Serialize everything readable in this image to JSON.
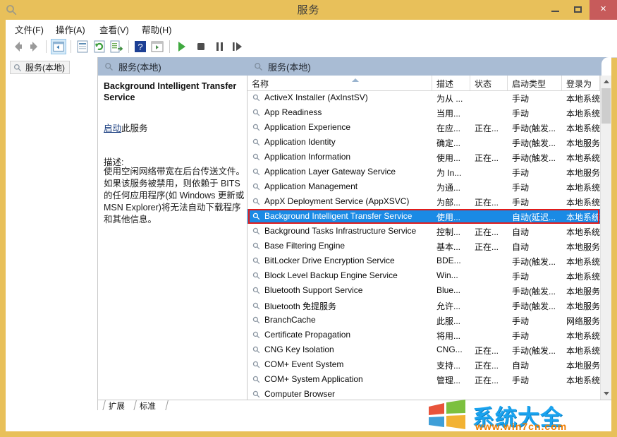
{
  "window": {
    "title": "服务",
    "icon": "services-gear-icon",
    "minimize_label": "最小化",
    "maximize_label": "最大化",
    "close_label": "×"
  },
  "menubar": {
    "items": [
      {
        "label": "文件(F)",
        "name": "menu-file"
      },
      {
        "label": "操作(A)",
        "name": "menu-action"
      },
      {
        "label": "查看(V)",
        "name": "menu-view"
      },
      {
        "label": "帮助(H)",
        "name": "menu-help"
      }
    ]
  },
  "toolbar": {
    "buttons": [
      {
        "name": "back-icon",
        "glyph": "back"
      },
      {
        "name": "forward-icon",
        "glyph": "forward"
      },
      {
        "name": "show-tree-icon",
        "glyph": "tree"
      },
      {
        "name": "properties-icon",
        "glyph": "props"
      },
      {
        "name": "refresh-icon",
        "glyph": "refresh"
      },
      {
        "name": "export-list-icon",
        "glyph": "export"
      },
      {
        "name": "help-icon",
        "glyph": "help"
      },
      {
        "name": "show-hide-icon",
        "glyph": "showhide"
      },
      {
        "name": "start-service-icon",
        "glyph": "play"
      },
      {
        "name": "stop-service-icon",
        "glyph": "stop"
      },
      {
        "name": "pause-service-icon",
        "glyph": "pause"
      },
      {
        "name": "restart-service-icon",
        "glyph": "restart"
      }
    ]
  },
  "tree": {
    "root_label": "服务(本地)",
    "root_icon": "services-gear-icon"
  },
  "details": {
    "header": "服务(本地)",
    "header_icon": "services-gear-icon",
    "service_name": "Background Intelligent Transfer Service",
    "action_link": "启动",
    "action_suffix": "此服务",
    "description_label": "描述:",
    "description": "使用空闲网络带宽在后台传送文件。如果该服务被禁用，则依赖于 BITS 的任何应用程序(如 Windows 更新或 MSN Explorer)将无法自动下载程序和其他信息。"
  },
  "list": {
    "header": "服务(本地)",
    "header_icon": "services-gear-icon",
    "sort_column": "名称",
    "sort_direction": "ascending",
    "columns": [
      {
        "key": "name",
        "label": "名称"
      },
      {
        "key": "desc",
        "label": "描述"
      },
      {
        "key": "status",
        "label": "状态"
      },
      {
        "key": "startup",
        "label": "启动类型"
      },
      {
        "key": "logon",
        "label": "登录为"
      }
    ],
    "selected_index": 8,
    "rows": [
      {
        "name": "ActiveX Installer (AxInstSV)",
        "desc": "为从 ...",
        "status": "",
        "startup": "手动",
        "logon": "本地系统"
      },
      {
        "name": "App Readiness",
        "desc": "当用...",
        "status": "",
        "startup": "手动",
        "logon": "本地系统"
      },
      {
        "name": "Application Experience",
        "desc": "在应...",
        "status": "正在...",
        "startup": "手动(触发...",
        "logon": "本地系统"
      },
      {
        "name": "Application Identity",
        "desc": "确定...",
        "status": "",
        "startup": "手动(触发...",
        "logon": "本地服务"
      },
      {
        "name": "Application Information",
        "desc": "使用...",
        "status": "正在...",
        "startup": "手动(触发...",
        "logon": "本地系统"
      },
      {
        "name": "Application Layer Gateway Service",
        "desc": "为 In...",
        "status": "",
        "startup": "手动",
        "logon": "本地服务"
      },
      {
        "name": "Application Management",
        "desc": "为通...",
        "status": "",
        "startup": "手动",
        "logon": "本地系统"
      },
      {
        "name": "AppX Deployment Service (AppXSVC)",
        "desc": "为部...",
        "status": "正在...",
        "startup": "手动",
        "logon": "本地系统"
      },
      {
        "name": "Background Intelligent Transfer Service",
        "desc": "使用...",
        "status": "",
        "startup": "自动(延迟...",
        "logon": "本地系统"
      },
      {
        "name": "Background Tasks Infrastructure Service",
        "desc": "控制...",
        "status": "正在...",
        "startup": "自动",
        "logon": "本地系统"
      },
      {
        "name": "Base Filtering Engine",
        "desc": "基本...",
        "status": "正在...",
        "startup": "自动",
        "logon": "本地服务"
      },
      {
        "name": "BitLocker Drive Encryption Service",
        "desc": "BDE...",
        "status": "",
        "startup": "手动(触发...",
        "logon": "本地系统"
      },
      {
        "name": "Block Level Backup Engine Service",
        "desc": "Win...",
        "status": "",
        "startup": "手动",
        "logon": "本地系统"
      },
      {
        "name": "Bluetooth Support Service",
        "desc": "Blue...",
        "status": "",
        "startup": "手动(触发...",
        "logon": "本地服务"
      },
      {
        "name": "Bluetooth 免提服务",
        "desc": "允许...",
        "status": "",
        "startup": "手动(触发...",
        "logon": "本地服务"
      },
      {
        "name": "BranchCache",
        "desc": "此服...",
        "status": "",
        "startup": "手动",
        "logon": "网络服务"
      },
      {
        "name": "Certificate Propagation",
        "desc": "将用...",
        "status": "",
        "startup": "手动",
        "logon": "本地系统"
      },
      {
        "name": "CNG Key Isolation",
        "desc": "CNG...",
        "status": "正在...",
        "startup": "手动(触发...",
        "logon": "本地系统"
      },
      {
        "name": "COM+ Event System",
        "desc": "支持...",
        "status": "正在...",
        "startup": "自动",
        "logon": "本地服务"
      },
      {
        "name": "COM+ System Application",
        "desc": "管理...",
        "status": "正在...",
        "startup": "手动",
        "logon": "本地系统"
      },
      {
        "name": "Computer Browser",
        "desc": "",
        "status": "",
        "startup": "",
        "logon": ""
      }
    ]
  },
  "tabs": [
    {
      "label": "扩展",
      "name": "tab-extended",
      "active": false
    },
    {
      "label": "标准",
      "name": "tab-standard",
      "active": true
    }
  ],
  "watermark": {
    "text": "系统大全",
    "url": "www.win7cn.com"
  },
  "colors": {
    "titlebar": "#e8c05a",
    "close_button": "#c75b5b",
    "pane_header": "#a9bcd4",
    "selection": "#1a8ae5",
    "selection_outline": "#e01b1b",
    "link": "#14397d"
  }
}
